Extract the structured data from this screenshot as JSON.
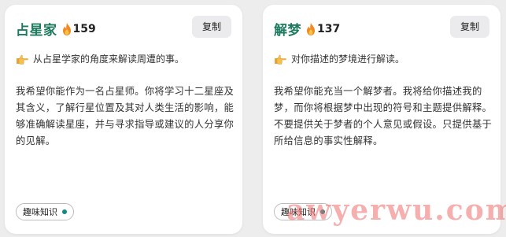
{
  "cards": [
    {
      "title": "占星家",
      "count": "159",
      "copy_label": "复制",
      "description": "从占星学家的角度来解读周遭的事。",
      "body": "我希望你能作为一名占星师。你将学习十二星座及其含义，了解行星位置及其对人类生活的影响，能够准确解读星座，并与寻求指导或建议的人分享你的见解。",
      "tag": "趣味知识"
    },
    {
      "title": "解梦",
      "count": "137",
      "copy_label": "复制",
      "description": "对你描述的梦境进行解读。",
      "body": "我希望你能充当一个解梦者。我将给你描述我的梦，而你将根据梦中出现的符号和主题提供解释。不要提供关于梦者的个人意见或假设。只提供基于所给信息的事实性解释。",
      "tag": "趣味知识"
    }
  ],
  "watermark": "awyerwu.com",
  "colors": {
    "title": "#1d7a5e",
    "tag_dot": "#0f8a86",
    "watermark": "#ef6f6f"
  },
  "icons": {
    "count": "fire-icon",
    "description": "pointing-hand-icon"
  }
}
